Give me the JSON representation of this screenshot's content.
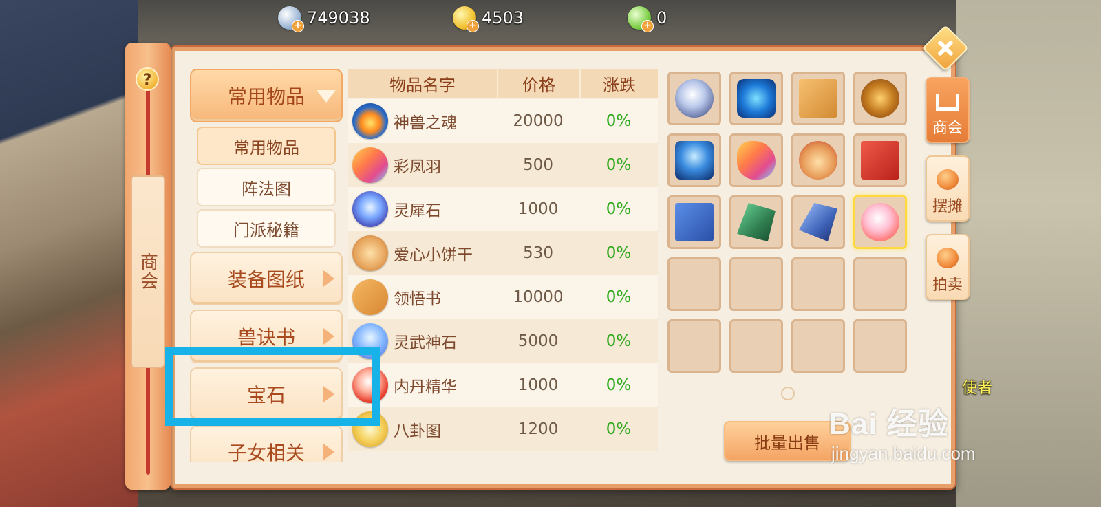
{
  "currencies": [
    {
      "icon": "silver-coin-icon",
      "value": "749038"
    },
    {
      "icon": "gold-coin-icon",
      "value": "4503"
    },
    {
      "icon": "jade-coin-icon",
      "value": "0"
    }
  ],
  "panel": {
    "help_label": "?",
    "vertical_title": "商会"
  },
  "menu": {
    "categories": [
      {
        "label": "常用物品",
        "expanded": true
      },
      {
        "label": "装备图纸"
      },
      {
        "label": "兽诀书"
      },
      {
        "label": "宝石",
        "highlighted": true
      },
      {
        "label": "子女相关"
      }
    ],
    "subcategories": [
      {
        "label": "常用物品",
        "active": true
      },
      {
        "label": "阵法图"
      },
      {
        "label": "门派秘籍"
      }
    ]
  },
  "table": {
    "headers": {
      "name": "物品名字",
      "price": "价格",
      "change": "涨跌"
    },
    "rows": [
      {
        "icon": "fire-orb-icon",
        "name": "神兽之魂",
        "price": "20000",
        "change": "0%"
      },
      {
        "icon": "feather-icon",
        "name": "彩凤羽",
        "price": "500",
        "change": "0%"
      },
      {
        "icon": "crystal-icon",
        "name": "灵犀石",
        "price": "1000",
        "change": "0%"
      },
      {
        "icon": "cookie-icon",
        "name": "爱心小饼干",
        "price": "530",
        "change": "0%"
      },
      {
        "icon": "book-icon",
        "name": "领悟书",
        "price": "10000",
        "change": "0%"
      },
      {
        "icon": "spirit-stone-icon",
        "name": "灵武神石",
        "price": "5000",
        "change": "0%"
      },
      {
        "icon": "elixir-orb-icon",
        "name": "内丹精华",
        "price": "1000",
        "change": "0%"
      },
      {
        "icon": "bagua-icon",
        "name": "八卦图",
        "price": "1200",
        "change": "0%"
      }
    ]
  },
  "inventory": {
    "slots": [
      {
        "icon": "diamond-icon"
      },
      {
        "icon": "blue-shield-icon"
      },
      {
        "icon": "orange-book-icon"
      },
      {
        "icon": "flower-pastry-icon"
      },
      {
        "icon": "phoenix-icon"
      },
      {
        "icon": "feather-icon"
      },
      {
        "icon": "heart-cookies-icon"
      },
      {
        "icon": "red-book-icon"
      },
      {
        "icon": "blue-book-icon"
      },
      {
        "icon": "green-rock-icon"
      },
      {
        "icon": "blue-rock-icon"
      },
      {
        "icon": "pink-gem-icon",
        "selected": true
      },
      {},
      {},
      {},
      {},
      {},
      {},
      {},
      {}
    ],
    "bulk_sell_label": "批量出售"
  },
  "side_tabs": [
    {
      "label": "商会",
      "active": true
    },
    {
      "label": "摆摊"
    },
    {
      "label": "拍卖"
    }
  ],
  "npc_label": "使者",
  "watermark": {
    "main": "Bai 经验",
    "sub": "jingyan.baidu.com"
  },
  "colors": {
    "accent": "#e7a06a",
    "change_text": "#2fa81d",
    "highlight_box": "#17b3e8",
    "selected_slot": "#ffd83d"
  }
}
